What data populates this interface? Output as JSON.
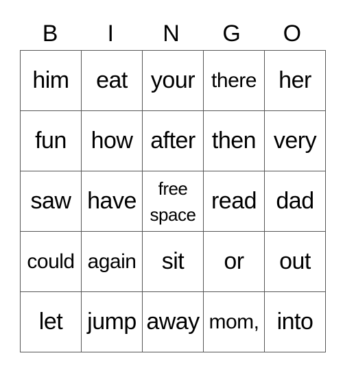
{
  "header": [
    "B",
    "I",
    "N",
    "G",
    "O"
  ],
  "rows": [
    [
      "him",
      "eat",
      "your",
      "there",
      "her"
    ],
    [
      "fun",
      "how",
      "after",
      "then",
      "very"
    ],
    [
      "saw",
      "have",
      "free space",
      "read",
      "dad"
    ],
    [
      "could",
      "again",
      "sit",
      "or",
      "out"
    ],
    [
      "let",
      "jump",
      "away",
      "mom,",
      "into"
    ]
  ]
}
